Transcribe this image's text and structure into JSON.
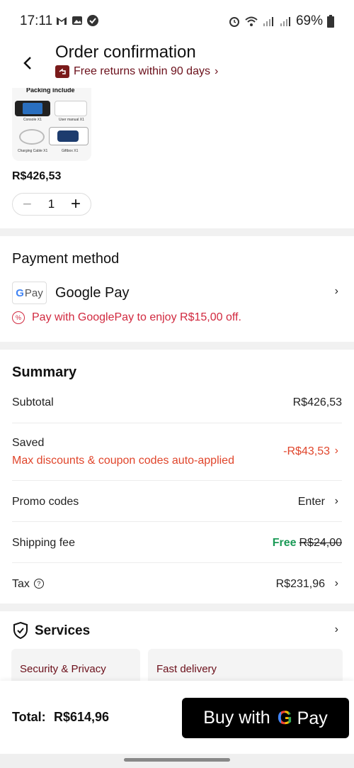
{
  "status_bar": {
    "time": "17:11",
    "battery": "69%",
    "left_icons": [
      "gmail-icon",
      "gallery-icon",
      "check-circle-icon"
    ],
    "right_icons": [
      "alarm-icon",
      "wifi-icon",
      "signal-icon",
      "signal-icon",
      "battery-icon"
    ]
  },
  "header": {
    "title": "Order confirmation",
    "returns_text": "Free returns within 90 days",
    "returns_chevron": "›"
  },
  "product": {
    "image_heading": "Packing include",
    "image_items": [
      "Console X1",
      "User manual X1",
      "Charging Cable X1",
      "Giftbox X1"
    ],
    "price": "R$426,53",
    "quantity": "1",
    "minus": "−",
    "plus": "+"
  },
  "payment": {
    "section_title": "Payment method",
    "badge_g": "G",
    "badge_text": "Pay",
    "method_label": "Google Pay",
    "chevron": "›",
    "promo_icon": "%",
    "promo_text": "Pay with GooglePay to enjoy R$15,00 off."
  },
  "summary": {
    "title": "Summary",
    "subtotal_label": "Subtotal",
    "subtotal_value": "R$426,53",
    "saved_label": "Saved",
    "saved_sub": "Max discounts & coupon codes auto-applied",
    "saved_value": "-R$43,53",
    "promo_label": "Promo codes",
    "promo_value": "Enter",
    "shipping_label": "Shipping fee",
    "shipping_free": "Free",
    "shipping_original": "R$24,00",
    "tax_label": "Tax",
    "tax_help": "?",
    "tax_value": "R$231,96",
    "chevron": "›"
  },
  "services": {
    "title": "Services",
    "chevron": "›",
    "cards": [
      "Security & Privacy",
      "Fast delivery"
    ]
  },
  "footer": {
    "total_label": "Total:",
    "total_value": "R$614,96",
    "buy_prefix": "Buy with",
    "buy_g": "G",
    "buy_pay": "Pay"
  },
  "colors": {
    "accent_red": "#d1293f",
    "discount_orange": "#e0452b",
    "free_green": "#1a9a56",
    "brand_maroon": "#6b0f1a"
  }
}
